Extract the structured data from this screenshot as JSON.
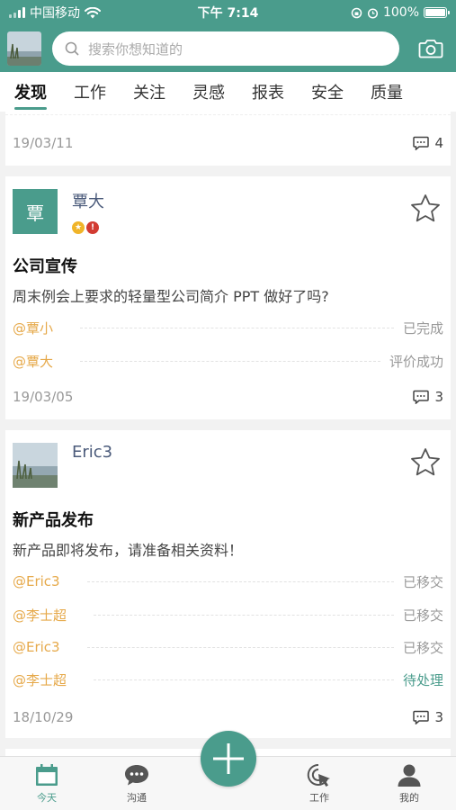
{
  "status_bar": {
    "carrier": "中国移动",
    "time": "下午 7:14",
    "battery": "100%",
    "battery_level": 1.0
  },
  "search": {
    "placeholder": "搜索你想知道的"
  },
  "tabs": [
    "发现",
    "工作",
    "关注",
    "灵感",
    "报表",
    "安全",
    "质量"
  ],
  "active_tab": "发现",
  "colors": {
    "accent": "#4a9c8c",
    "mention": "#e6a94a",
    "muted": "#999999"
  },
  "feed": {
    "partial_card": {
      "date": "19/03/11",
      "comments": "4"
    },
    "posts": [
      {
        "author": "覃大",
        "avatar_text": "覃",
        "title": "公司宣传",
        "body": "周末例会上要求的轻量型公司简介 PPT 做好了吗?",
        "assignments": [
          {
            "user": "@覃小",
            "status": "已完成"
          },
          {
            "user": "@覃大",
            "status": "评价成功"
          }
        ],
        "date": "19/03/05",
        "comments": "3"
      },
      {
        "author": "Eric3",
        "title": "新产品发布",
        "body": "新产品即将发布，请准备相关资料！",
        "assignments": [
          {
            "user": "@Eric3",
            "status": "已移交"
          },
          {
            "user": "@李士超",
            "status": "已移交"
          },
          {
            "user": "@Eric3",
            "status": "已移交"
          },
          {
            "user": "@李士超",
            "status": "待处理"
          }
        ],
        "date": "18/10/29",
        "comments": "3"
      }
    ]
  },
  "bottom_nav": [
    {
      "label": "今天",
      "icon": "calendar-icon"
    },
    {
      "label": "沟通",
      "icon": "chat-icon"
    },
    {
      "label": "工作",
      "icon": "cursor-click-icon"
    },
    {
      "label": "我的",
      "icon": "user-icon"
    }
  ],
  "fab_icon": "plus-icon"
}
